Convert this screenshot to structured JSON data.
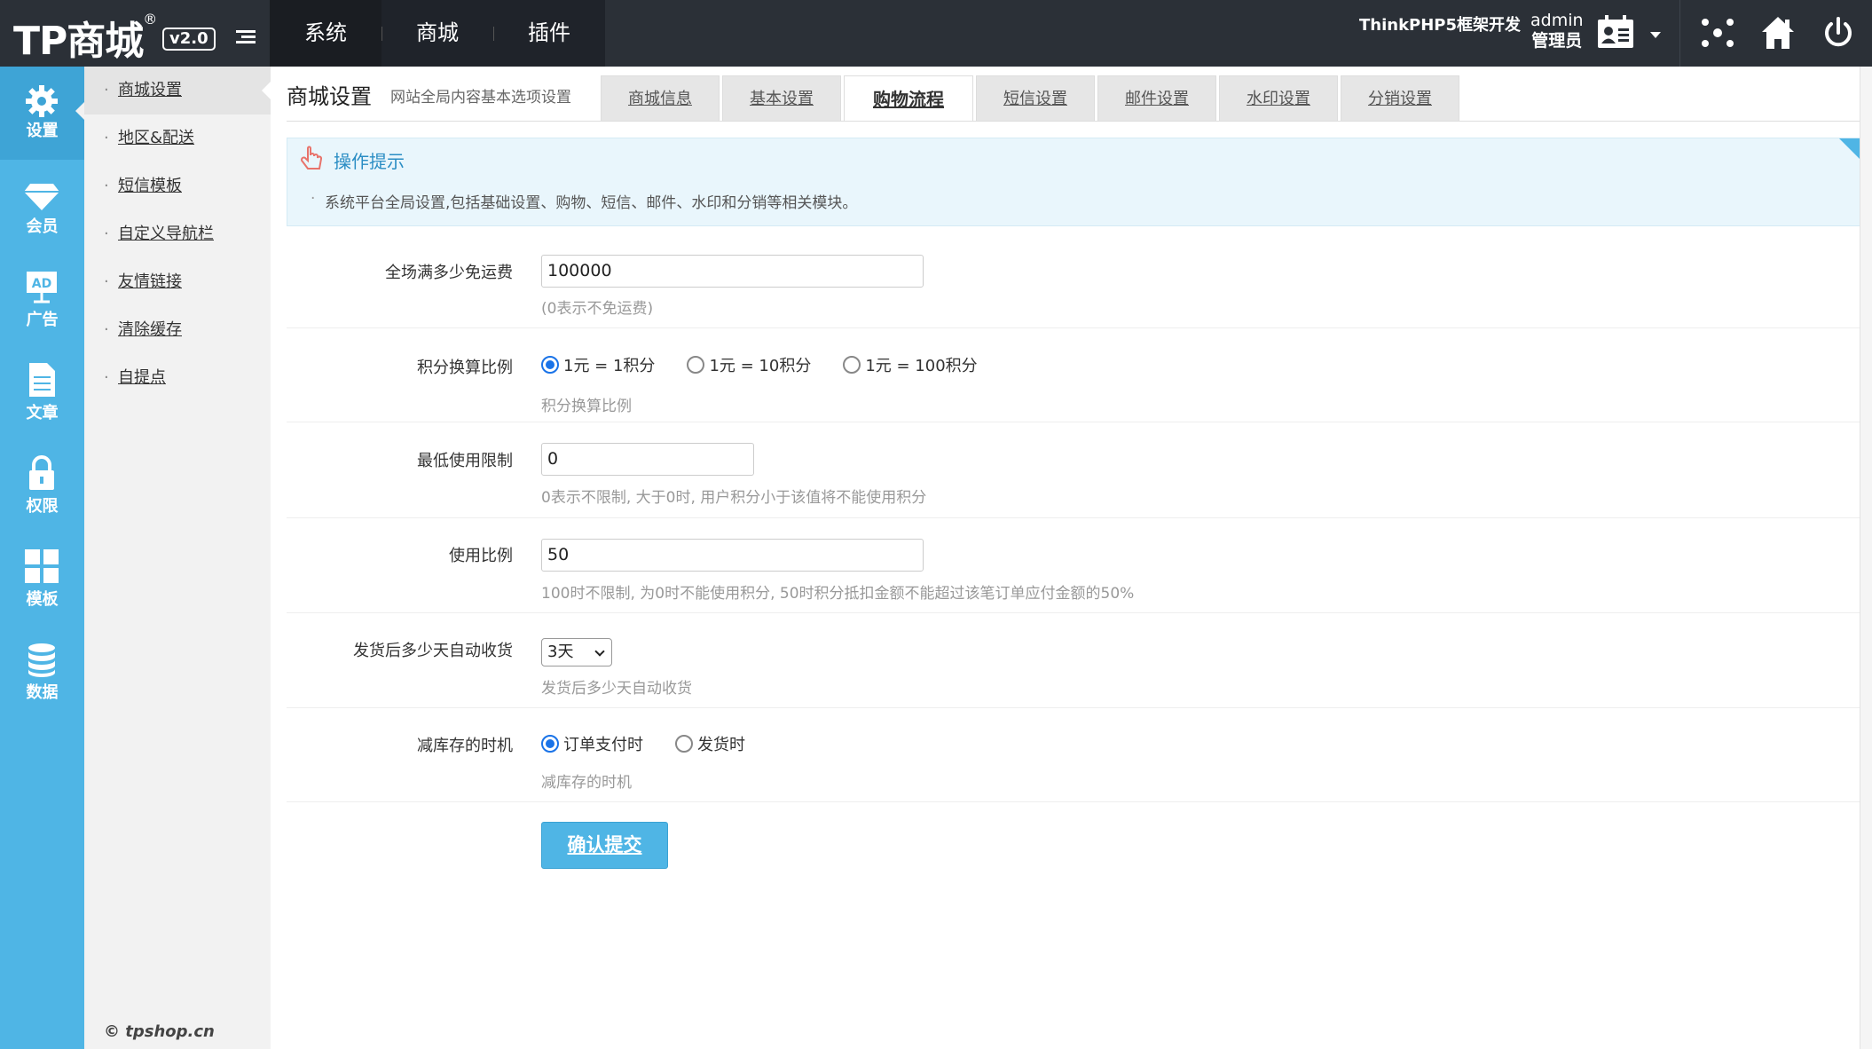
{
  "brand": {
    "logo_text": "TP商城",
    "logo_mark": "®",
    "version": "v2.0"
  },
  "top_nav": [
    {
      "label": "系统",
      "active": true
    },
    {
      "label": "商城",
      "active": false
    },
    {
      "label": "插件",
      "active": false
    }
  ],
  "header": {
    "framework": "ThinkPHP5框架开发",
    "user": "admin",
    "role": "管理员",
    "icons": [
      "id-card-icon",
      "chevron-down-icon",
      "sitemap-icon",
      "home-icon",
      "power-icon"
    ]
  },
  "icon_sidebar": [
    {
      "label": "设置",
      "icon": "gear-icon",
      "active": true
    },
    {
      "label": "会员",
      "icon": "diamond-icon",
      "active": false
    },
    {
      "label": "广告",
      "icon": "ad-board-icon",
      "active": false
    },
    {
      "label": "文章",
      "icon": "document-icon",
      "active": false
    },
    {
      "label": "权限",
      "icon": "lock-icon",
      "active": false
    },
    {
      "label": "模板",
      "icon": "grid-icon",
      "active": false
    },
    {
      "label": "数据",
      "icon": "database-icon",
      "active": false
    }
  ],
  "sub_menu": [
    {
      "label": "商城设置",
      "active": true
    },
    {
      "label": "地区&配送",
      "active": false
    },
    {
      "label": "短信模板",
      "active": false
    },
    {
      "label": "自定义导航栏",
      "active": false
    },
    {
      "label": "友情链接",
      "active": false
    },
    {
      "label": "清除缓存",
      "active": false
    },
    {
      "label": "自提点",
      "active": false
    }
  ],
  "copyright": "© tpshop.cn",
  "page": {
    "title": "商城设置",
    "subtitle": "网站全局内容基本选项设置"
  },
  "tabs": [
    {
      "label": "商城信息",
      "active": false
    },
    {
      "label": "基本设置",
      "active": false
    },
    {
      "label": "购物流程",
      "active": true
    },
    {
      "label": "短信设置",
      "active": false
    },
    {
      "label": "邮件设置",
      "active": false
    },
    {
      "label": "水印设置",
      "active": false
    },
    {
      "label": "分销设置",
      "active": false
    }
  ],
  "tips": {
    "title": "操作提示",
    "text": "系统平台全局设置,包括基础设置、购物、短信、邮件、水印和分销等相关模块。"
  },
  "form": {
    "free_shipping": {
      "label": "全场满多少免运费",
      "value": "100000",
      "hint": "(0表示不免运费)"
    },
    "points_ratio": {
      "label": "积分换算比例",
      "options": [
        "1元 = 1积分",
        "1元 = 10积分",
        "1元 = 100积分"
      ],
      "selected": 0,
      "hint": "积分换算比例"
    },
    "min_use": {
      "label": "最低使用限制",
      "value": "0",
      "hint": "0表示不限制, 大于0时, 用户积分小于该值将不能使用积分"
    },
    "use_ratio": {
      "label": "使用比例",
      "value": "50",
      "hint": "100时不限制, 为0时不能使用积分, 50时积分抵扣金额不能超过该笔订单应付金额的50%"
    },
    "auto_receive": {
      "label": "发货后多少天自动收货",
      "value": "3天",
      "hint": "发货后多少天自动收货"
    },
    "stock_timing": {
      "label": "减库存的时机",
      "options": [
        "订单支付时",
        "发货时"
      ],
      "selected": 0,
      "hint": "减库存的时机"
    },
    "submit": "确认提交"
  },
  "colors": {
    "topbar": "#2b3037",
    "accent": "#4fb5e5",
    "tips_bg": "#e9f6fc",
    "radio_checked": "#1a73e8"
  }
}
